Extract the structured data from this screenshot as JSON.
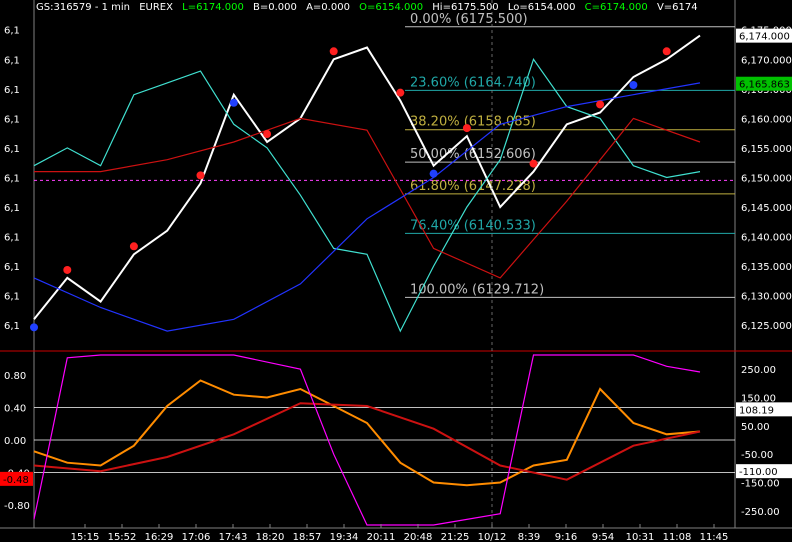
{
  "header": {
    "symbol": "GS:316579 - 1 min",
    "exchange": "EUREX",
    "last": "L=6174.000",
    "bid": "B=0.000",
    "ask": "A=0.000",
    "open": "O=6154.000",
    "high": "Hi=6175.500",
    "low": "Lo=6154.000",
    "close": "C=6174.000",
    "volume": "V=6174"
  },
  "colors": {
    "background": "#000000",
    "price": "#ffffff",
    "cyan_line": "#40e0d0",
    "red_ma": "#cc1111",
    "blue_ma": "#2233ff",
    "yellow_ma": "#e0e020",
    "green_ma": "#22aa22",
    "fib_teal": "#20a8a8",
    "fib_olive": "#c0b040",
    "osc_orange": "#ff8c00",
    "osc_gray": "#c8c8c8",
    "osc_magenta": "#ff00ff"
  },
  "chart_data": [
    {
      "type": "line",
      "panel": "price",
      "y_tick_labels_left": [
        "6,1",
        "6,1",
        "6,1",
        "6,1",
        "6,1",
        "6,1",
        "6,1",
        "6,1",
        "6,1",
        "6,1",
        "6,1"
      ],
      "y_ticks_right": [
        6175,
        6170,
        6165,
        6160,
        6155,
        6150,
        6145,
        6140,
        6135,
        6130,
        6125
      ],
      "y_tick_labels_right": [
        "6,175.000",
        "6,170.000",
        "6,165.000",
        "6,160.000",
        "6,155.000",
        "6,150.000",
        "6,145.000",
        "6,140.000",
        "6,135.000",
        "6,130.000",
        "6,125.000"
      ],
      "ylim": [
        6122.5,
        6178
      ],
      "price_labels": [
        {
          "text": "6,174.000",
          "value": 6174.0,
          "bg": "#ffffff",
          "fg": "#000000"
        },
        {
          "text": "6,165.863",
          "value": 6165.863,
          "bg": "#00c000",
          "fg": "#000000"
        }
      ],
      "fibonacci": [
        {
          "label": "0.00% (6175.500)",
          "value": 6175.5,
          "color": "#c0c0c0"
        },
        {
          "label": "23.60% (6164.740)",
          "value": 6164.74,
          "color": "#20a8a8"
        },
        {
          "label": "38.20% (6158.085)",
          "value": 6158.085,
          "color": "#c0b040"
        },
        {
          "label": "50.00% (6152.606)",
          "value": 6152.606,
          "color": "#c0c0c0"
        },
        {
          "label": "61.80% (6147.228)",
          "value": 6147.228,
          "color": "#c0b040"
        },
        {
          "label": "76.40% (6140.533)",
          "value": 6140.533,
          "color": "#20a8a8"
        },
        {
          "label": "100.00% (6129.712)",
          "value": 6129.712,
          "color": "#c0c0c0"
        }
      ],
      "dashed_level": 6149.5,
      "series": [
        {
          "color": "#ffffff",
          "x": [
            0,
            5,
            10,
            15,
            20,
            25,
            30,
            35,
            40,
            45,
            50,
            55,
            60,
            65,
            70,
            75,
            80,
            85,
            90,
            95,
            100
          ],
          "y": [
            6126,
            6133,
            6129,
            6137,
            6141,
            6149,
            6164,
            6156,
            6160,
            6170,
            6172,
            6163,
            6152,
            6157,
            6145,
            6151,
            6159,
            6161,
            6167,
            6170,
            6174
          ]
        },
        {
          "color": "#40e0d0",
          "x": [
            0,
            5,
            10,
            15,
            20,
            25,
            30,
            35,
            40,
            45,
            50,
            55,
            60,
            65,
            70,
            75,
            80,
            85,
            90,
            95,
            100
          ],
          "y": [
            6152,
            6155,
            6152,
            6164,
            6166,
            6168,
            6159,
            6155,
            6147,
            6138,
            6137,
            6124,
            6135,
            6145,
            6153,
            6170,
            6162,
            6160,
            6152,
            6150,
            6151
          ]
        },
        {
          "color": "#cc1111",
          "x": [
            0,
            10,
            20,
            30,
            40,
            50,
            60,
            70,
            80,
            90,
            100
          ],
          "y": [
            6151,
            6151,
            6153,
            6156,
            6160,
            6158,
            6138,
            6133,
            6146,
            6160,
            6156
          ]
        },
        {
          "color": "#2233ff",
          "x": [
            0,
            10,
            20,
            30,
            40,
            50,
            60,
            70,
            80,
            90,
            100
          ],
          "y": [
            6133,
            6128,
            6124,
            6126,
            6132,
            6143,
            6150,
            6159,
            6162,
            6164,
            6166
          ]
        }
      ]
    },
    {
      "type": "line",
      "panel": "oscillator",
      "y_ticks_left": [
        0.8,
        0.4,
        0.0,
        -0.4,
        -0.8
      ],
      "y_tick_labels_left": [
        "0.80",
        "0.40",
        "0.00",
        "-0.40",
        "-0.80"
      ],
      "y_ticks_right": [
        250,
        150,
        50,
        -50,
        -150,
        -250
      ],
      "y_tick_labels_right": [
        "250.00",
        "150.00",
        "50.00",
        "-50.00",
        "-150.00",
        "-250.00"
      ],
      "value_labels": [
        {
          "text": "108.19",
          "value": 108.19,
          "bg": "#ffffff",
          "fg": "#000000"
        },
        {
          "text": "-110.00",
          "value": -110.0,
          "bg": "#ffffff",
          "fg": "#000000"
        },
        {
          "text": "-0.48",
          "value": -0.48,
          "bg": "#ff0000",
          "fg": "#000000",
          "side": "left"
        }
      ],
      "series": [
        {
          "color": "#ff8c00",
          "x": [
            0,
            5,
            10,
            15,
            20,
            25,
            30,
            35,
            40,
            45,
            50,
            55,
            60,
            65,
            70,
            75,
            80,
            85,
            90,
            95,
            100
          ],
          "y": [
            -40,
            -80,
            -90,
            -20,
            120,
            210,
            160,
            150,
            180,
            120,
            60,
            -80,
            -150,
            -160,
            -150,
            -90,
            -70,
            180,
            60,
            20,
            30
          ]
        },
        {
          "color": "#cc1111",
          "x": [
            0,
            10,
            20,
            30,
            40,
            50,
            60,
            70,
            80,
            90,
            100
          ],
          "y": [
            -90,
            -110,
            -60,
            20,
            130,
            120,
            40,
            -90,
            -140,
            -20,
            30
          ]
        },
        {
          "color": "#ff00ff",
          "x": [
            0,
            5,
            10,
            20,
            30,
            40,
            45,
            50,
            60,
            70,
            75,
            80,
            90,
            95,
            100
          ],
          "y": [
            -280,
            290,
            300,
            300,
            300,
            250,
            -50,
            -300,
            -300,
            -260,
            300,
            300,
            300,
            260,
            240
          ]
        }
      ]
    }
  ],
  "x_axis": {
    "tick_labels": [
      "15:15",
      "15:52",
      "16:29",
      "17:06",
      "17:43",
      "18:20",
      "18:57",
      "19:34",
      "20:11",
      "20:48",
      "21:25",
      "10/12",
      "8:39",
      "9:16",
      "9:54",
      "10:31",
      "11:08",
      "11:45"
    ],
    "separator_label": "10/12"
  }
}
